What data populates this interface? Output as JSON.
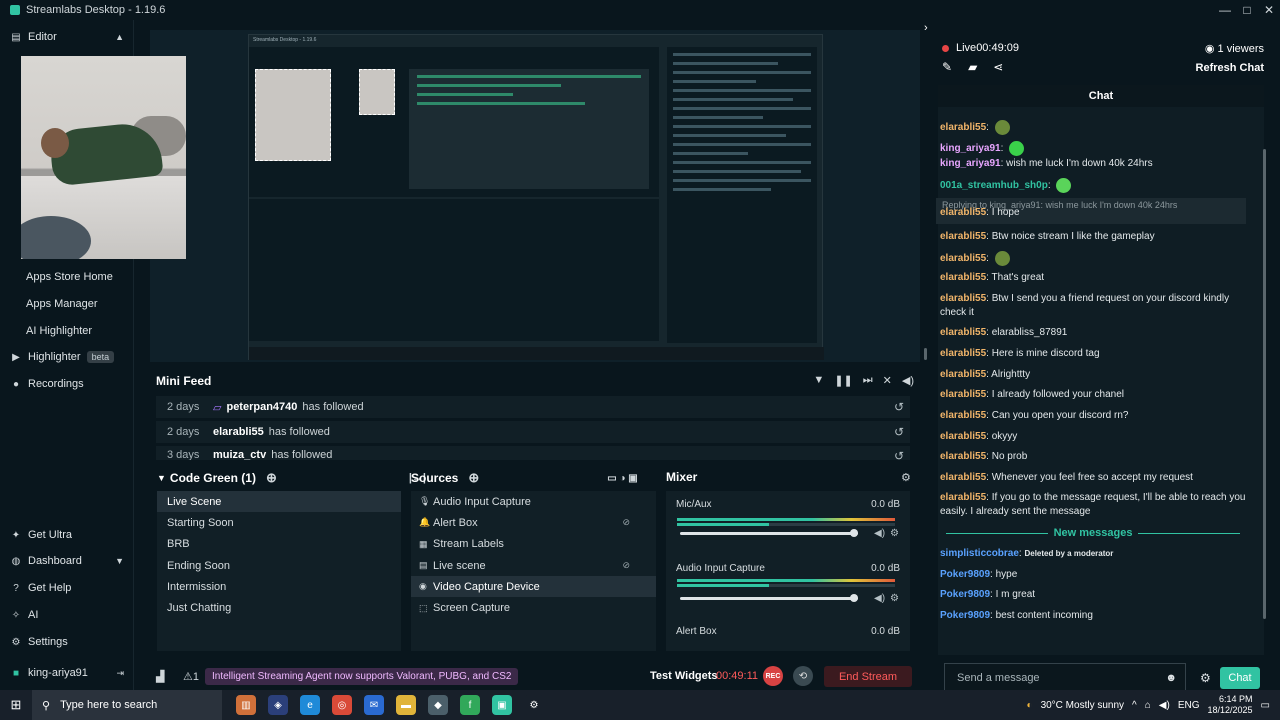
{
  "window": {
    "title": "Streamlabs Desktop - 1.19.6",
    "min": "—",
    "max": "□",
    "close": "✕"
  },
  "sidebar": {
    "editor": "Editor",
    "items": [
      {
        "label": "Apps Store Home"
      },
      {
        "label": "Apps Manager"
      },
      {
        "label": "AI Highlighter"
      },
      {
        "label": "Highlighter",
        "badge": "beta"
      },
      {
        "label": "Recordings"
      }
    ],
    "bottom": [
      {
        "label": "Get Ultra"
      },
      {
        "label": "Dashboard"
      },
      {
        "label": "Get Help"
      },
      {
        "label": "AI"
      },
      {
        "label": "Settings"
      }
    ],
    "user": "king-ariya91"
  },
  "preview": {
    "title": "Streamlabs Desktop - 1.19.6"
  },
  "minifeed": {
    "title": "Mini Feed",
    "rows": [
      {
        "age": "2 days",
        "user": "peterpan4740",
        "action": "has followed"
      },
      {
        "age": "2 days",
        "user": "elarabli55",
        "action": "has followed"
      },
      {
        "age": "3 days",
        "user": "muiza_ctv",
        "action": "has followed"
      }
    ]
  },
  "scenes": {
    "title": "Code Green (1)",
    "items": [
      "Live Scene",
      "Starting Soon",
      "BRB",
      "Ending Soon",
      "Intermission",
      "Just Chatting"
    ],
    "active": 0
  },
  "sources": {
    "title": "Sources",
    "items": [
      "Audio Input Capture",
      "Alert Box",
      "Stream Labels",
      "Live scene",
      "Video Capture Device",
      "Screen Capture"
    ],
    "active": 4
  },
  "mixer": {
    "title": "Mixer",
    "channels": [
      {
        "name": "Mic/Aux",
        "db": "0.0 dB"
      },
      {
        "name": "Audio Input Capture",
        "db": "0.0 dB"
      },
      {
        "name": "Alert Box",
        "db": "0.0 dB"
      }
    ]
  },
  "footer": {
    "alert": "Intelligent Streaming Agent now supports Valorant, PUBG, and CS2",
    "test_widgets": "Test Widgets",
    "timer": "00:49:11",
    "rec": "REC",
    "end_stream": "End Stream",
    "alert_count": "1"
  },
  "chat": {
    "live_label": "Live",
    "live_time": "00:49:09",
    "viewers": "1 viewers",
    "refresh": "Refresh Chat",
    "title": "Chat",
    "messages": [
      {
        "user": "elarabli55",
        "text": ""
      },
      {
        "user": "king_ariya91",
        "text": ""
      },
      {
        "user": "king_ariya91",
        "text": "wish me luck I'm down 40k 24hrs"
      },
      {
        "user": "001a_streamhub_sh0p",
        "text": ""
      },
      {
        "user": "elarabli55",
        "text": "I hope"
      },
      {
        "user": "elarabli55",
        "text": "Btw noice stream I like the gameplay"
      },
      {
        "user": "elarabli55",
        "text": ""
      },
      {
        "user": "elarabli55",
        "text": "That's great"
      },
      {
        "user": "elarabli55",
        "text": "Btw I send you a friend request on your discord kindly check it"
      },
      {
        "user": "elarabli55",
        "text": "elarabliss_87891"
      },
      {
        "user": "elarabli55",
        "text": "Here is mine discord tag"
      },
      {
        "user": "elarabli55",
        "text": "Alrighttty"
      },
      {
        "user": "elarabli55",
        "text": "I already followed your chanel"
      },
      {
        "user": "elarabli55",
        "text": "Can you open your discord rn?"
      },
      {
        "user": "elarabli55",
        "text": "okyyy"
      },
      {
        "user": "elarabli55",
        "text": "No prob"
      },
      {
        "user": "elarabli55",
        "text": "Whenever you feel free so accept my request"
      },
      {
        "user": "elarabli55",
        "text": "If you go to the message request, I'll be able to reach you easily. I already sent the message"
      },
      {
        "user": "simplisticcobrae",
        "text": "Deleted by a moderator"
      },
      {
        "user": "Poker9809",
        "text": "hype"
      },
      {
        "user": "Poker9809",
        "text": "I m great"
      },
      {
        "user": "Poker9809",
        "text": "best content incoming"
      }
    ],
    "reply_to": "Replying to king_ariya91: wish me luck I'm down 40k 24hrs",
    "new_messages": "New messages",
    "placeholder": "Send a message",
    "send": "Chat"
  },
  "taskbar": {
    "search": "Type here to search",
    "weather": "30°C  Mostly sunny",
    "lang": "ENG",
    "time": "6:14 PM",
    "date": "18/12/2025"
  },
  "colors": {
    "accent": "#31c3a2",
    "live": "#e64545",
    "username_default": "#f1b56a",
    "username_blue": "#5aa2ff"
  }
}
